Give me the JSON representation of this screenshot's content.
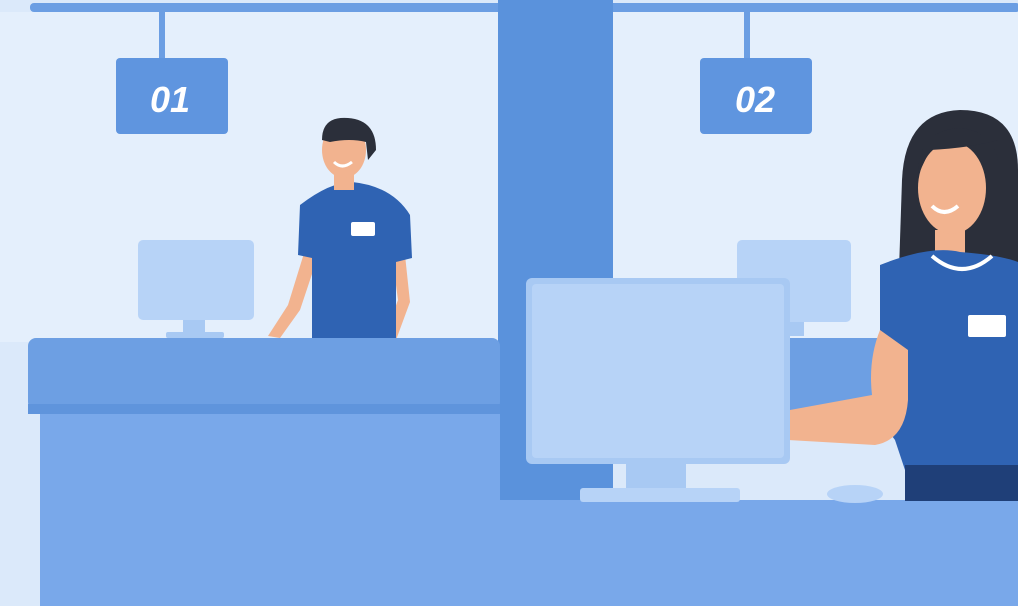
{
  "scene": {
    "description_title": "",
    "signs": [
      {
        "label": "01"
      },
      {
        "label": "02"
      }
    ],
    "colors": {
      "background": "#dbe9fa",
      "panel_dark": "#5a92dc",
      "counter_top": "#6d9fe3",
      "counter_front": "#79a8ea",
      "monitor": "#a8c9f3",
      "shirt": "#2f63b3",
      "skin": "#f2b38f",
      "hair": "#2b2f3a",
      "sign": "#5f95df"
    }
  }
}
